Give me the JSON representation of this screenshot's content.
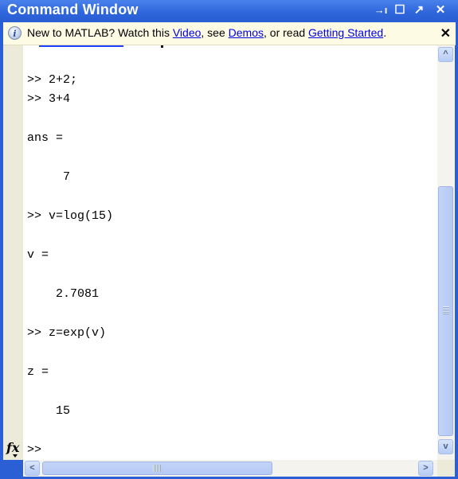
{
  "window": {
    "title": "Command Window",
    "buttons": {
      "undock": "→ı",
      "maximize": "☐",
      "undock_arrow": "↗",
      "close": "✕"
    }
  },
  "notice": {
    "prefix": "New to MATLAB? Watch this ",
    "link_video": "Video",
    "mid1": ", see ",
    "link_demos": "Demos",
    "mid2": ", or read ",
    "link_getting_started": "Getting Started",
    "suffix": ".",
    "close": "✕"
  },
  "console": {
    "lines": [
      ">> 2+2;",
      ">> 3+4",
      "ans =",
      "     7",
      ">> v=log(15)",
      "v =",
      "    2.7081",
      ">> z=exp(v)",
      "z =",
      "    15",
      ">> "
    ]
  },
  "gutter": {
    "fx_label": "fx"
  },
  "scrollbars": {
    "up_arrow": "^",
    "down_arrow": "v",
    "left_arrow": "<",
    "right_arrow": ">"
  }
}
